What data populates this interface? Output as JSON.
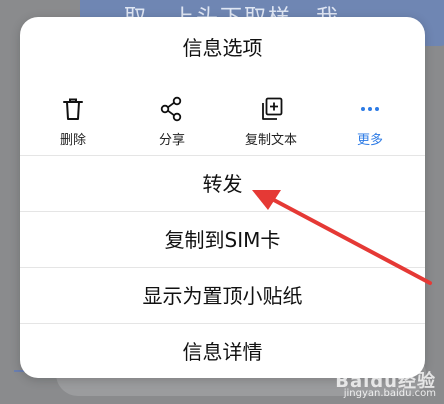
{
  "background": {
    "bubble_text": "取，上头下取样，我"
  },
  "sheet": {
    "title": "信息选项",
    "actions": [
      {
        "label": "删除",
        "icon": "trash-icon"
      },
      {
        "label": "分享",
        "icon": "share-icon"
      },
      {
        "label": "复制文本",
        "icon": "copy-text-icon"
      },
      {
        "label": "更多",
        "icon": "more-icon"
      }
    ],
    "options": [
      {
        "label": "转发"
      },
      {
        "label": "复制到SIM卡"
      },
      {
        "label": "显示为置顶小贴纸"
      },
      {
        "label": "信息详情"
      }
    ]
  },
  "annotation": {
    "arrow_color": "#e53935"
  },
  "watermark": {
    "brand": "Baidu经验",
    "url": "jingyan.baidu.com"
  },
  "colors": {
    "accent": "#2d7be5",
    "sheet_bg": "#ffffff",
    "overlay_bg": "#8a8b8d"
  }
}
